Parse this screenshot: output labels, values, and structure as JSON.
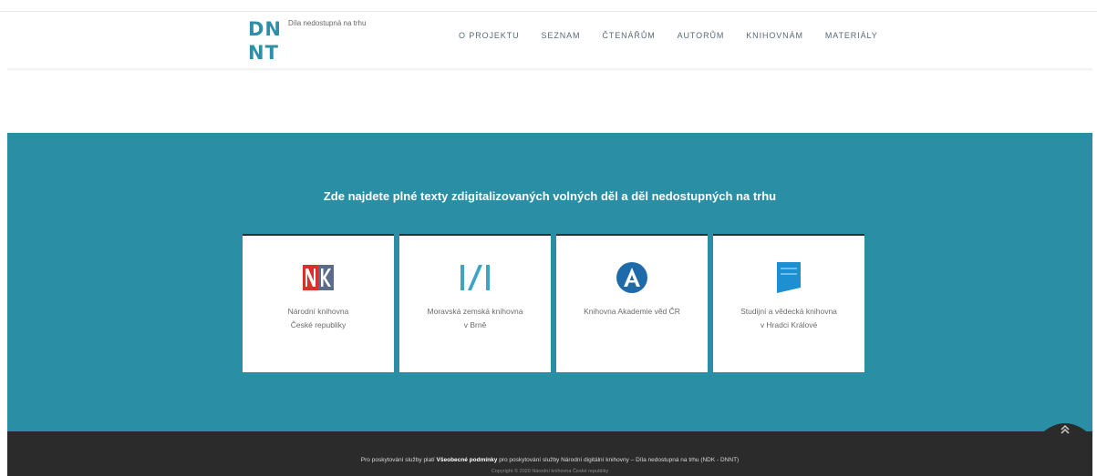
{
  "header": {
    "logo_line1": "DN",
    "logo_line2": "NT",
    "logo_tagline": "Díla nedostupná na trhu",
    "nav": [
      {
        "label": "O PROJEKTU"
      },
      {
        "label": "SEZNAM"
      },
      {
        "label": "ČTENÁŘŮM"
      },
      {
        "label": "AUTORŮM"
      },
      {
        "label": "KNIHOVNÁM"
      },
      {
        "label": "MATERIÁLY"
      }
    ]
  },
  "main": {
    "heading": "Zde najdete plné texty zdigitalizovaných volných děl a děl nedostupných na trhu",
    "cards": [
      {
        "label_line1": "Národní knihovna",
        "label_line2": "České republiky",
        "icon": "nk-logo-icon",
        "icon_color": "#d9302c"
      },
      {
        "label_line1": "Moravská zemská knihovna",
        "label_line2": "v Brně",
        "icon": "mzk-logo-icon",
        "icon_color": "#3aa6c4"
      },
      {
        "label_line1": "Knihovna Akademie věd ČR",
        "label_line2": "",
        "icon": "knav-logo-icon",
        "icon_color": "#1f6aa8"
      },
      {
        "label_line1": "Studijní a vědecká knihovna",
        "label_line2": "v Hradci Králové",
        "icon": "svkhk-logo-icon",
        "icon_color": "#1e8fd0"
      }
    ]
  },
  "footer": {
    "line1_prefix": "Pro poskytování služby platí",
    "line1_link": "Všeobecné podmínky",
    "line1_suffix": "pro poskytování služby Národní digitální knihovny – Díla nedostupná na trhu (NDK - DNNT)",
    "line2": "Copyright © 2020 Národní knihovna České republiky"
  },
  "colors": {
    "brand_teal": "#2a8fa4",
    "footer_dark": "#2b2b2b",
    "logo_blue": "#2f8fa9"
  }
}
